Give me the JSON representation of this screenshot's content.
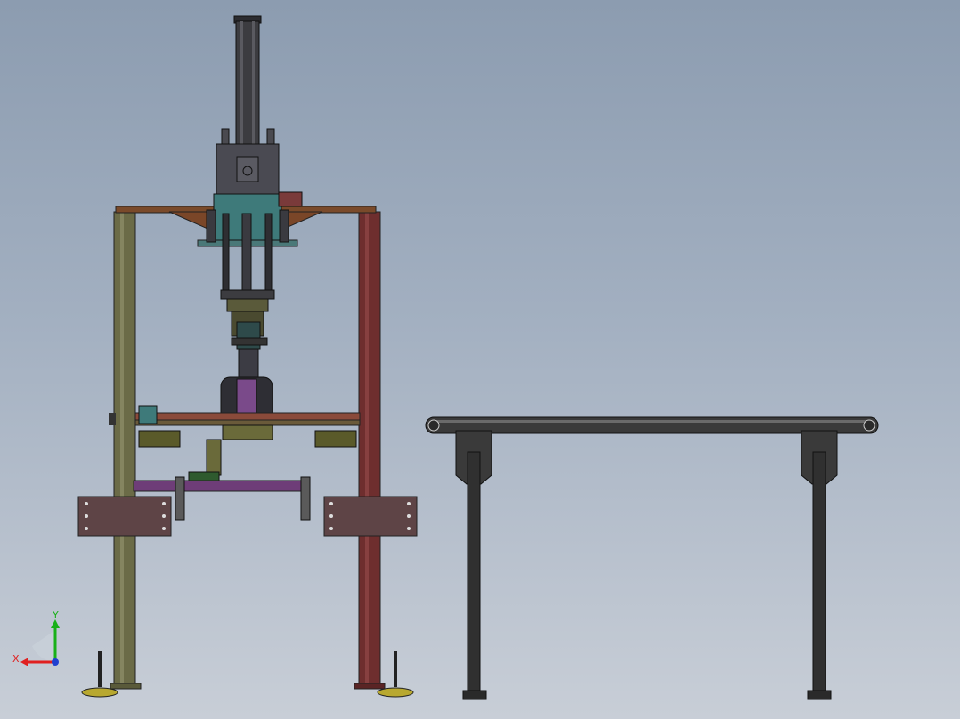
{
  "triad": {
    "x_label": "X",
    "y_label": "Y",
    "x_color": "#e02020",
    "y_color": "#18b018",
    "z_color": "#2040d0"
  },
  "colors": {
    "background_top": "#8c9cb0",
    "background_bottom": "#c8ced7",
    "frame_left_post": "#6b6b47",
    "frame_right_post": "#6e2e2e",
    "top_beam": "#7a4a2a",
    "cylinder": "#3c3c40",
    "teal_block": "#3e7a7a",
    "purple_bar": "#6e3d78",
    "conveyor": "#3a3a3a",
    "foot_pad": "#b8a830"
  }
}
